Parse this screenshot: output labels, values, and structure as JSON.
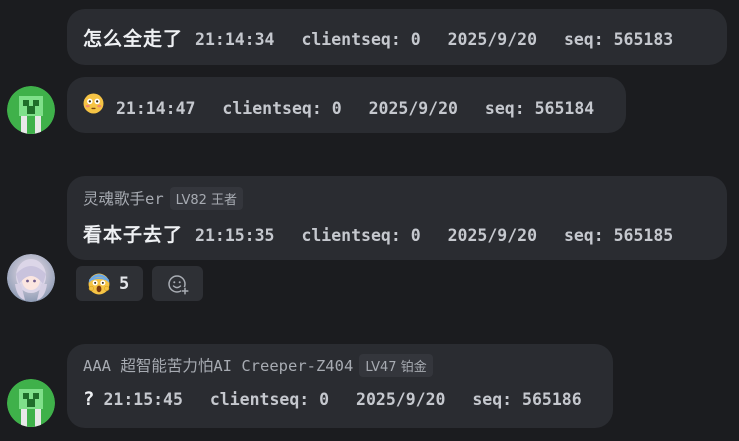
{
  "messages": [
    {
      "text": "怎么全走了",
      "time": "21:14:34",
      "clientseq": "clientseq: 0",
      "date": "2025/9/20",
      "seq": "seq: 565183"
    },
    {
      "emoji": "flushed-face",
      "time": "21:14:47",
      "clientseq": "clientseq: 0",
      "date": "2025/9/20",
      "seq": "seq: 565184"
    },
    {
      "sender": "灵魂歌手er",
      "level": "LV82 王者",
      "text": "看本子去了",
      "time": "21:15:35",
      "clientseq": "clientseq: 0",
      "date": "2025/9/20",
      "seq": "seq: 565185",
      "reactions": [
        {
          "emoji": "screaming-face",
          "count": "5"
        }
      ],
      "add_reaction_icon": "add-emoji-icon"
    },
    {
      "sender": "AAA 超智能苦力怕AI Creeper-Z404",
      "level": "LV47 铂金",
      "text": "?",
      "time": "21:15:45",
      "clientseq": "clientseq: 0",
      "date": "2025/9/20",
      "seq": "seq: 565186"
    }
  ],
  "colors": {
    "background": "#1b1c1f",
    "bubble": "#2a2c31",
    "badge": "#34363c",
    "creeper_green": "#3fb14a"
  }
}
